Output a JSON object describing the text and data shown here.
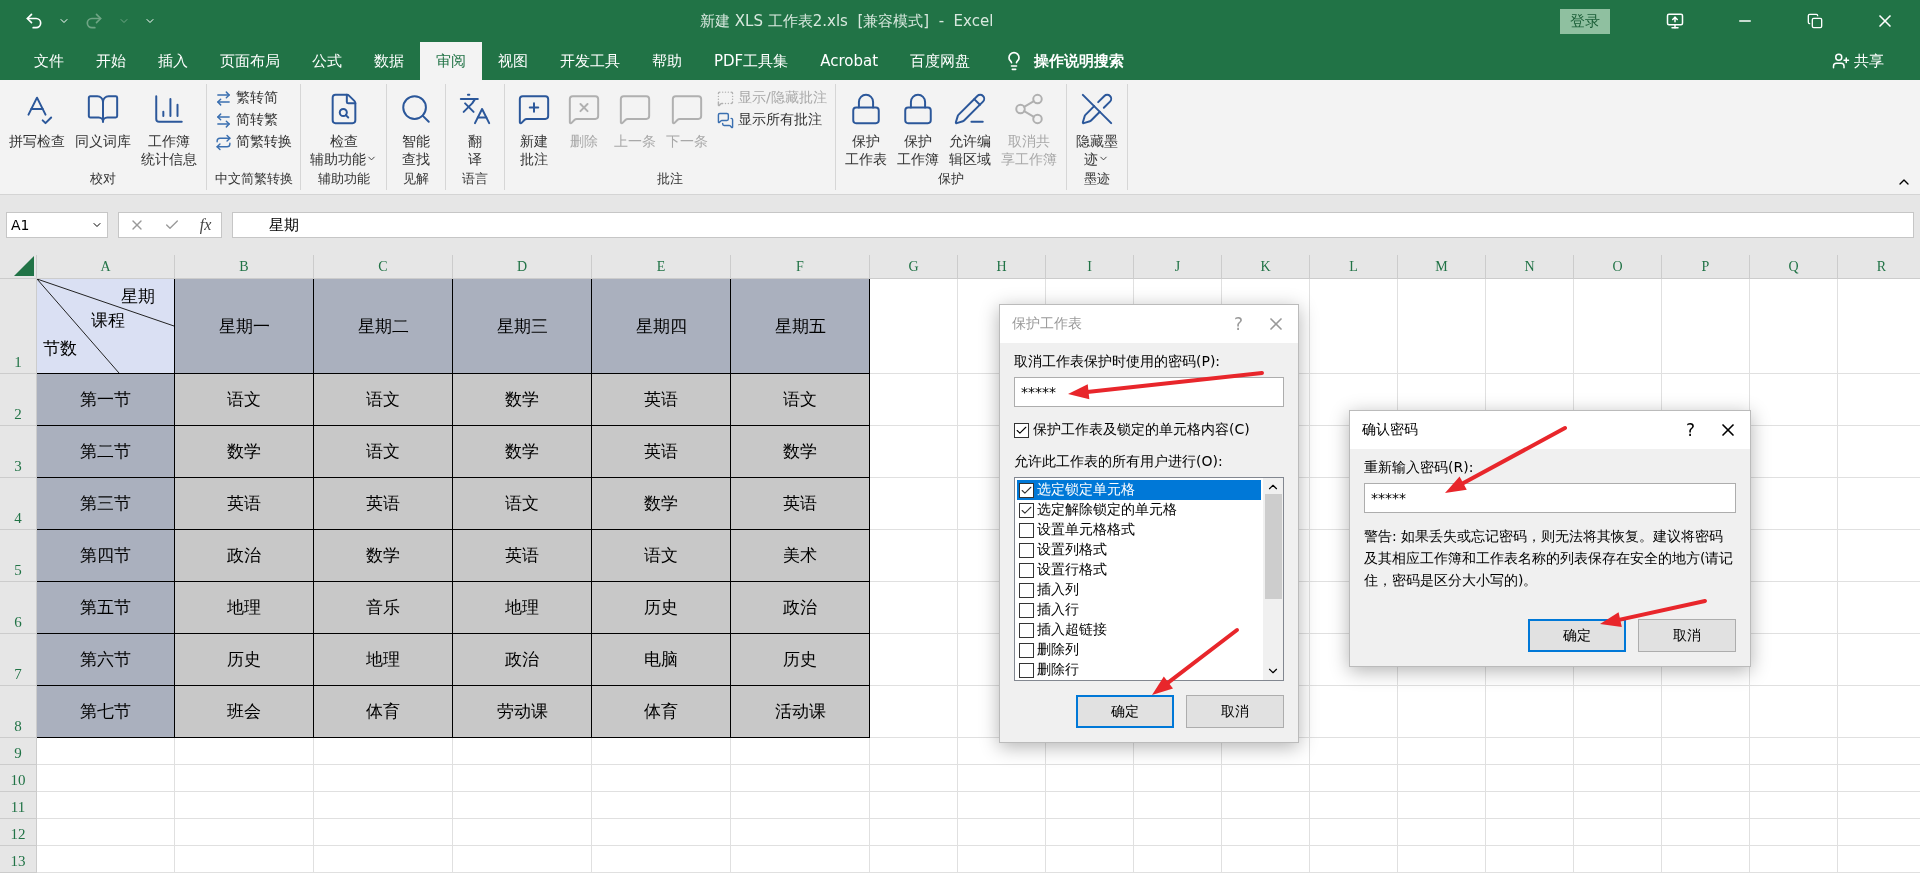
{
  "window": {
    "title": "新建 XLS 工作表2.xls  [兼容模式]  -  Excel",
    "login": "登录"
  },
  "menu_tabs": [
    {
      "label": "文件",
      "selected": false
    },
    {
      "label": "开始",
      "selected": false
    },
    {
      "label": "插入",
      "selected": false
    },
    {
      "label": "页面布局",
      "selected": false
    },
    {
      "label": "公式",
      "selected": false
    },
    {
      "label": "数据",
      "selected": false
    },
    {
      "label": "审阅",
      "selected": true
    },
    {
      "label": "视图",
      "selected": false
    },
    {
      "label": "开发工具",
      "selected": false
    },
    {
      "label": "帮助",
      "selected": false
    },
    {
      "label": "PDF工具集",
      "selected": false
    },
    {
      "label": "Acrobat",
      "selected": false
    },
    {
      "label": "百度网盘",
      "selected": false
    }
  ],
  "tell_me": "操作说明搜索",
  "share": "共享",
  "ribbon_groups": [
    {
      "label": "校对",
      "buttons": [
        {
          "kind": "large",
          "lines": [
            "拼写检查"
          ],
          "disabled": false
        },
        {
          "kind": "large",
          "lines": [
            "同义词库"
          ],
          "disabled": false
        },
        {
          "kind": "large",
          "lines": [
            "工作簿",
            "统计信息"
          ],
          "disabled": false
        }
      ]
    },
    {
      "label": "中文简繁转换",
      "buttons": [
        {
          "kind": "small",
          "lines": [
            "繁转简"
          ],
          "disabled": false
        },
        {
          "kind": "small",
          "lines": [
            "简转繁"
          ],
          "disabled": false
        },
        {
          "kind": "small",
          "lines": [
            "简繁转换"
          ],
          "disabled": false
        }
      ]
    },
    {
      "label": "辅助功能",
      "buttons": [
        {
          "kind": "large",
          "lines": [
            "检查",
            "辅助功能"
          ],
          "disabled": false,
          "dropdown": true
        }
      ]
    },
    {
      "label": "见解",
      "buttons": [
        {
          "kind": "large",
          "lines": [
            "智能",
            "查找"
          ],
          "disabled": false
        }
      ]
    },
    {
      "label": "语言",
      "buttons": [
        {
          "kind": "large",
          "lines": [
            "翻",
            "译"
          ],
          "disabled": false
        }
      ]
    },
    {
      "label": "批注",
      "buttons": [
        {
          "kind": "large",
          "lines": [
            "新建",
            "批注"
          ],
          "disabled": false
        },
        {
          "kind": "large",
          "lines": [
            "删除"
          ],
          "disabled": true
        },
        {
          "kind": "large",
          "lines": [
            "上一条"
          ],
          "disabled": true
        },
        {
          "kind": "large",
          "lines": [
            "下一条"
          ],
          "disabled": true
        },
        {
          "kind": "small",
          "lines": [
            "显示/隐藏批注"
          ],
          "disabled": true
        },
        {
          "kind": "small",
          "lines": [
            "显示所有批注"
          ],
          "disabled": false
        }
      ]
    },
    {
      "label": "保护",
      "buttons": [
        {
          "kind": "large",
          "lines": [
            "保护",
            "工作表"
          ],
          "disabled": false
        },
        {
          "kind": "large",
          "lines": [
            "保护",
            "工作簿"
          ],
          "disabled": false
        },
        {
          "kind": "large",
          "lines": [
            "允许编",
            "辑区域"
          ],
          "disabled": false
        },
        {
          "kind": "large",
          "lines": [
            "取消共",
            "享工作簿"
          ],
          "disabled": true
        }
      ]
    },
    {
      "label": "墨迹",
      "buttons": [
        {
          "kind": "large",
          "lines": [
            "隐藏墨",
            "迹"
          ],
          "disabled": false,
          "dropdown": true
        }
      ]
    }
  ],
  "formula_bar": {
    "name_box": "A1",
    "fx_label": "fx",
    "formula": "星期"
  },
  "columns": [
    "A",
    "B",
    "C",
    "D",
    "E",
    "F",
    "G",
    "H",
    "I",
    "J",
    "K",
    "L",
    "M",
    "N",
    "O",
    "P",
    "Q",
    "R"
  ],
  "row_numbers": [
    "1",
    "2",
    "3",
    "4",
    "5",
    "6",
    "7",
    "8",
    "9",
    "10",
    "11",
    "12",
    "13"
  ],
  "corner_header": {
    "top": "星期",
    "middle": "课程",
    "bottom": "节数"
  },
  "days": [
    "星期一",
    "星期二",
    "星期三",
    "星期四",
    "星期五"
  ],
  "periods": [
    {
      "label": "第一节",
      "cells": [
        "语文",
        "语文",
        "数学",
        "英语",
        "语文"
      ]
    },
    {
      "label": "第二节",
      "cells": [
        "数学",
        "语文",
        "数学",
        "英语",
        "数学"
      ]
    },
    {
      "label": "第三节",
      "cells": [
        "英语",
        "英语",
        "语文",
        "数学",
        "英语"
      ]
    },
    {
      "label": "第四节",
      "cells": [
        "政治",
        "数学",
        "英语",
        "语文",
        "美术"
      ]
    },
    {
      "label": "第五节",
      "cells": [
        "地理",
        "音乐",
        "地理",
        "历史",
        "政治"
      ]
    },
    {
      "label": "第六节",
      "cells": [
        "历史",
        "地理",
        "政治",
        "电脑",
        "历史"
      ]
    },
    {
      "label": "第七节",
      "cells": [
        "班会",
        "体育",
        "劳动课",
        "体育",
        "活动课"
      ]
    }
  ],
  "protect_dialog": {
    "title": "保护工作表",
    "help": "?",
    "password_label": "取消工作表保护时使用的密码(P):",
    "password": "*****",
    "protect_checkbox": {
      "label": "保护工作表及锁定的单元格内容(C)",
      "checked": true
    },
    "allow_label": "允许此工作表的所有用户进行(O):",
    "permissions": [
      {
        "label": "选定锁定单元格",
        "checked": true,
        "selected": true
      },
      {
        "label": "选定解除锁定的单元格",
        "checked": true,
        "selected": false
      },
      {
        "label": "设置单元格格式",
        "checked": false,
        "selected": false
      },
      {
        "label": "设置列格式",
        "checked": false,
        "selected": false
      },
      {
        "label": "设置行格式",
        "checked": false,
        "selected": false
      },
      {
        "label": "插入列",
        "checked": false,
        "selected": false
      },
      {
        "label": "插入行",
        "checked": false,
        "selected": false
      },
      {
        "label": "插入超链接",
        "checked": false,
        "selected": false
      },
      {
        "label": "删除列",
        "checked": false,
        "selected": false
      },
      {
        "label": "删除行",
        "checked": false,
        "selected": false
      }
    ],
    "ok": "确定",
    "cancel": "取消"
  },
  "confirm_dialog": {
    "title": "确认密码",
    "help": "?",
    "label": "重新输入密码(R):",
    "password": "*****",
    "warning": "警告: 如果丢失或忘记密码，则无法将其恢复。建议将密码及其相应工作簿和工作表名称的列表保存在安全的地方(请记住，密码是区分大小写的)。",
    "ok": "确定",
    "cancel": "取消"
  }
}
